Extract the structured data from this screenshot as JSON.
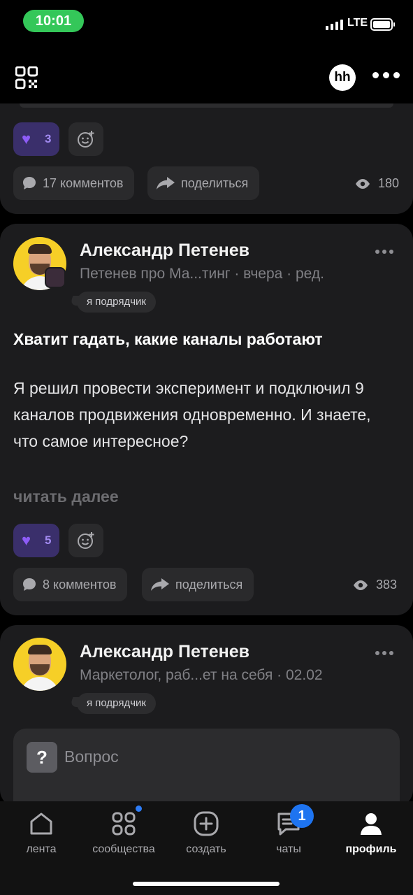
{
  "status_bar": {
    "time": "10:01",
    "network": "LTE"
  },
  "app_bar": {
    "avatar_text": "hh"
  },
  "posts": [
    {
      "reaction_count": "3",
      "comments_label": "17 комментов",
      "share_label": "поделиться",
      "views": "180"
    },
    {
      "author": "Александр Петенев",
      "meta": "Петенев про Ма...тинг · вчера · ред.",
      "role": "я подрядчик",
      "title": "Хватит гадать, какие каналы работают",
      "body": "Я решил провести эксперимент и подключил 9 каналов продвижения одновременно. И знаете, что самое интересное?",
      "read_more": "читать далее",
      "reaction_count": "5",
      "comments_label": "8 комментов",
      "share_label": "поделиться",
      "views": "383"
    },
    {
      "author": "Александр Петенев",
      "meta": "Маркетолог, раб...ет на себя · 02.02",
      "role": "я подрядчик",
      "question_label": "Вопрос",
      "question_icon": "?"
    }
  ],
  "tabs": [
    {
      "label": "лента",
      "icon": "home-icon"
    },
    {
      "label": "сообщества",
      "icon": "grid-icon",
      "dot": true
    },
    {
      "label": "создать",
      "icon": "plus-icon"
    },
    {
      "label": "чаты",
      "icon": "chat-icon",
      "badge": "1"
    },
    {
      "label": "профиль",
      "icon": "profile-icon",
      "active": true
    }
  ],
  "colors": {
    "background": "#000000",
    "card": "#1c1c1e",
    "reaction_bg": "#3a2f6b",
    "heart": "#8e5cf7",
    "badge": "#1e74f0",
    "time_pill": "#34c759"
  }
}
